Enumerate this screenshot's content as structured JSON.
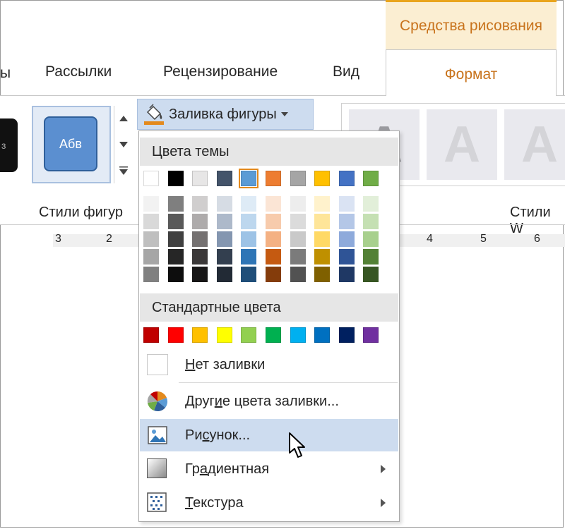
{
  "context_tab": {
    "title": "Средства рисования"
  },
  "tabs": [
    {
      "label": "Рассылки"
    },
    {
      "label": "Рецензирование"
    },
    {
      "label": "Вид"
    },
    {
      "label": "Формат"
    }
  ],
  "tab_cut_fragment": "ы",
  "shape_styles": {
    "preview_text": "Абв",
    "black_fragment": "ɜ",
    "group_label": "Стили фигур"
  },
  "fill_button": {
    "label": "Заливка фигуры"
  },
  "wordart": {
    "letter": "A",
    "group_label": "Стили W"
  },
  "ruler": {
    "numbers": [
      "3",
      "2",
      "4",
      "5",
      "6"
    ]
  },
  "dropdown": {
    "theme_header": "Цвета темы",
    "theme_colors": [
      "#ffffff",
      "#000000",
      "#e7e6e6",
      "#44546a",
      "#5b9bd5",
      "#ed7d31",
      "#a5a5a5",
      "#ffc000",
      "#4472c4",
      "#70ad47"
    ],
    "theme_shades": [
      [
        "#f2f2f2",
        "#d9d9d9",
        "#bfbfbf",
        "#a6a6a6",
        "#808080"
      ],
      [
        "#7f7f7f",
        "#595959",
        "#404040",
        "#262626",
        "#0d0d0d"
      ],
      [
        "#d0cece",
        "#aeabab",
        "#757171",
        "#3b3838",
        "#171616"
      ],
      [
        "#d6dce4",
        "#adb9ca",
        "#8496b0",
        "#333f4f",
        "#222a35"
      ],
      [
        "#deebf6",
        "#bdd7ee",
        "#9dc3e6",
        "#2e75b6",
        "#1f4e79"
      ],
      [
        "#fbe5d5",
        "#f7cbac",
        "#f4b183",
        "#c55a11",
        "#843c0b"
      ],
      [
        "#ededed",
        "#dbdbdb",
        "#c9c9c9",
        "#7b7b7b",
        "#525252"
      ],
      [
        "#fff2cc",
        "#fee599",
        "#ffd965",
        "#bf9000",
        "#7f6000"
      ],
      [
        "#dae3f3",
        "#b4c7e7",
        "#8eaadb",
        "#2f5496",
        "#1f3864"
      ],
      [
        "#e2efd9",
        "#c5e0b3",
        "#a8d08d",
        "#538135",
        "#375623"
      ]
    ],
    "selected_theme_index": 4,
    "standard_header": "Стандартные цвета",
    "standard_colors": [
      "#c00000",
      "#ff0000",
      "#ffc000",
      "#ffff00",
      "#92d050",
      "#00b050",
      "#00b0f0",
      "#0070c0",
      "#002060",
      "#7030a0"
    ],
    "no_fill": {
      "underline": "Н",
      "rest": "ет заливки"
    },
    "more_colors": {
      "pre": "Друг",
      "underline": "и",
      "post": "е цвета заливки..."
    },
    "picture": {
      "pre": "Ри",
      "underline": "с",
      "post": "унок..."
    },
    "gradient": {
      "pre": "Гр",
      "underline": "а",
      "post": "диентная"
    },
    "texture": {
      "underline": "Т",
      "rest": "екстура"
    }
  },
  "icons": {
    "fill": "paint-bucket-icon",
    "more": "color-wheel-icon",
    "picture": "picture-icon",
    "gradient": "gradient-icon",
    "texture": "texture-icon"
  }
}
